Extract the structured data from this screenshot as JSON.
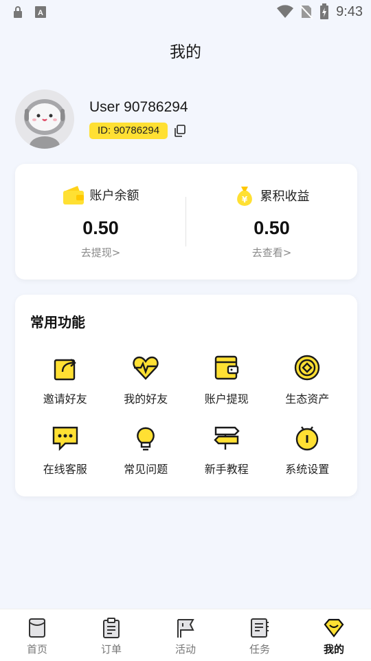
{
  "status_bar": {
    "time": "9:43"
  },
  "page": {
    "title": "我的"
  },
  "profile": {
    "username": "User 90786294",
    "id_text": "ID: 90786294"
  },
  "balance": {
    "account": {
      "label": "账户余额",
      "value": "0.50",
      "link": "去提现>"
    },
    "earnings": {
      "label": "累积收益",
      "value": "0.50",
      "link": "去查看>"
    }
  },
  "functions": {
    "title": "常用功能",
    "items": [
      {
        "label": "邀请好友",
        "icon": "share-icon"
      },
      {
        "label": "我的好友",
        "icon": "heart-pulse-icon"
      },
      {
        "label": "账户提现",
        "icon": "wallet-icon"
      },
      {
        "label": "生态资产",
        "icon": "coin-target-icon"
      },
      {
        "label": "在线客服",
        "icon": "chat-icon"
      },
      {
        "label": "常见问题",
        "icon": "lightbulb-icon"
      },
      {
        "label": "新手教程",
        "icon": "signpost-icon"
      },
      {
        "label": "系统设置",
        "icon": "settings-icon"
      }
    ]
  },
  "nav": [
    {
      "label": "首页",
      "icon": "home-icon"
    },
    {
      "label": "订单",
      "icon": "order-icon"
    },
    {
      "label": "活动",
      "icon": "flag-icon"
    },
    {
      "label": "任务",
      "icon": "task-icon"
    },
    {
      "label": "我的",
      "icon": "profile-gem-icon",
      "active": true
    }
  ],
  "colors": {
    "accent": "#ffe033",
    "background": "#f3f6fd",
    "icon_stroke": "#1a1a1a"
  }
}
